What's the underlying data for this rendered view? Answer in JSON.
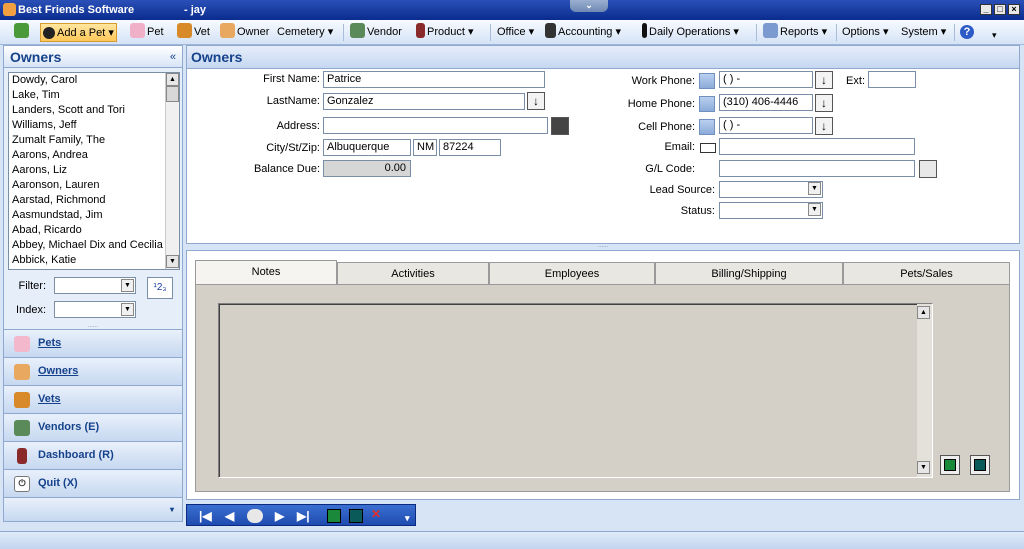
{
  "window": {
    "app_title": "Best Friends Software",
    "user": "- jay",
    "minimize": "_",
    "maximize": "□",
    "close": "×",
    "notch": "⌄"
  },
  "toolbar": {
    "add_pet": "Add a Pet",
    "pet": "Pet",
    "vet": "Vet",
    "owner": "Owner",
    "cemetery": "Cemetery",
    "vendor": "Vendor",
    "product": "Product",
    "office": "Office",
    "accounting": "Accounting",
    "daily_operations": "Daily Operations",
    "reports": "Reports",
    "options": "Options",
    "system": "System",
    "dropdown_glyph": "▾",
    "help_glyph": "?"
  },
  "left_panel": {
    "title": "Owners",
    "collapse_glyph": "«",
    "owners": [
      "Dowdy, Carol",
      "Lake, Tim",
      "Landers, Scott and Tori",
      "Williams, Jeff",
      "Zumalt Family, The",
      "Aarons, Andrea",
      "Aarons, Liz",
      "Aaronson, Lauren",
      "Aarstad, Richmond",
      "Aasmundstad, Jim",
      "Abad, Ricardo",
      "Abbey, Michael Dix and Cecilia",
      "Abbick, Katie"
    ],
    "filter_label": "Filter:",
    "index_label": "Index:",
    "sort_glyph": "¹2₃",
    "grip": "......",
    "nav": [
      "Pets",
      "Owners",
      "Vets",
      "Vendors (E)",
      "Dashboard (R)",
      "Quit (X)"
    ]
  },
  "main": {
    "title": "Owners",
    "form": {
      "first_name_label": "First Name:",
      "first_name": "Patrice",
      "last_name_label": "LastName:",
      "last_name": "Gonzalez",
      "address_label": "Address:",
      "address": "",
      "city_label": "City/St/Zip:",
      "city": "Albuquerque",
      "state": "NM",
      "zip": "87224",
      "balance_label": "Balance Due:",
      "balance": "0.00",
      "work_phone_label": "Work Phone:",
      "work_phone": "(   )   -",
      "ext_label": "Ext:",
      "ext": "",
      "home_phone_label": "Home Phone:",
      "home_phone": "(310) 406-4446",
      "cell_phone_label": "Cell Phone:",
      "cell_phone": "(   )   -",
      "email_label": "Email:",
      "email": "",
      "gl_code_label": "G/L Code:",
      "gl_code": "",
      "lead_source_label": "Lead Source:",
      "lead_source": "",
      "status_label": "Status:",
      "status": "",
      "arrow_glyph": "↓",
      "dropdown_glyph": "▼"
    },
    "tabs": [
      "Notes",
      "Activities",
      "Employees",
      "Billing/Shipping",
      "Pets/Sales"
    ],
    "notes": "",
    "splitter_grip": "......"
  },
  "navbar": {
    "first": "|◀",
    "prev": "◀",
    "next": "▶",
    "last": "▶|",
    "delete": "✕",
    "more": "▾"
  }
}
